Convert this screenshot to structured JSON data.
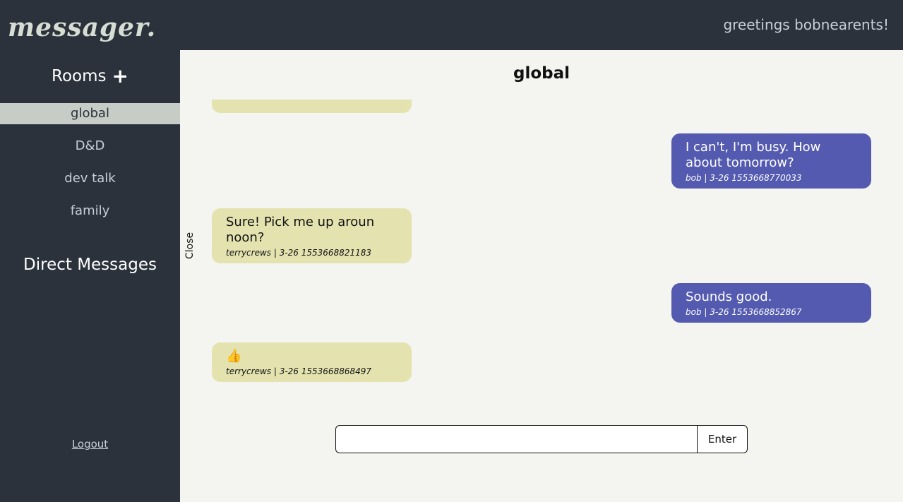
{
  "app": {
    "logo": "messager.",
    "greeting": "greetings bobnearents!"
  },
  "sidebar": {
    "rooms_heading": "Rooms",
    "add_room_icon": "+",
    "rooms": [
      {
        "label": "global",
        "active": true
      },
      {
        "label": "D&D",
        "active": false
      },
      {
        "label": "dev talk",
        "active": false
      },
      {
        "label": "family",
        "active": false
      }
    ],
    "dm_heading": "Direct Messages",
    "logout": "Logout"
  },
  "main": {
    "room_title": "global",
    "close_label": "Close",
    "messages": [
      {
        "from": "other",
        "text": "",
        "meta": ""
      },
      {
        "from": "self",
        "text": "I can't, I'm busy. How about tomorrow?",
        "meta": "bob | 3-26 1553668770033"
      },
      {
        "from": "other",
        "text": "Sure! Pick me up aroun noon?",
        "meta": "terrycrews | 3-26 1553668821183"
      },
      {
        "from": "self",
        "text": "Sounds good.",
        "meta": "bob | 3-26 1553668852867"
      },
      {
        "from": "other",
        "text": "👍",
        "meta": "terrycrews | 3-26 1553668868497"
      }
    ],
    "composer": {
      "input_value": "",
      "enter_label": "Enter"
    }
  },
  "colors": {
    "bg_dark": "#2b323c",
    "main_bg": "#f4f5f0",
    "bubble_other": "#e4e3b0",
    "bubble_self": "#545aaf",
    "active_room": "#c8ccc6"
  }
}
